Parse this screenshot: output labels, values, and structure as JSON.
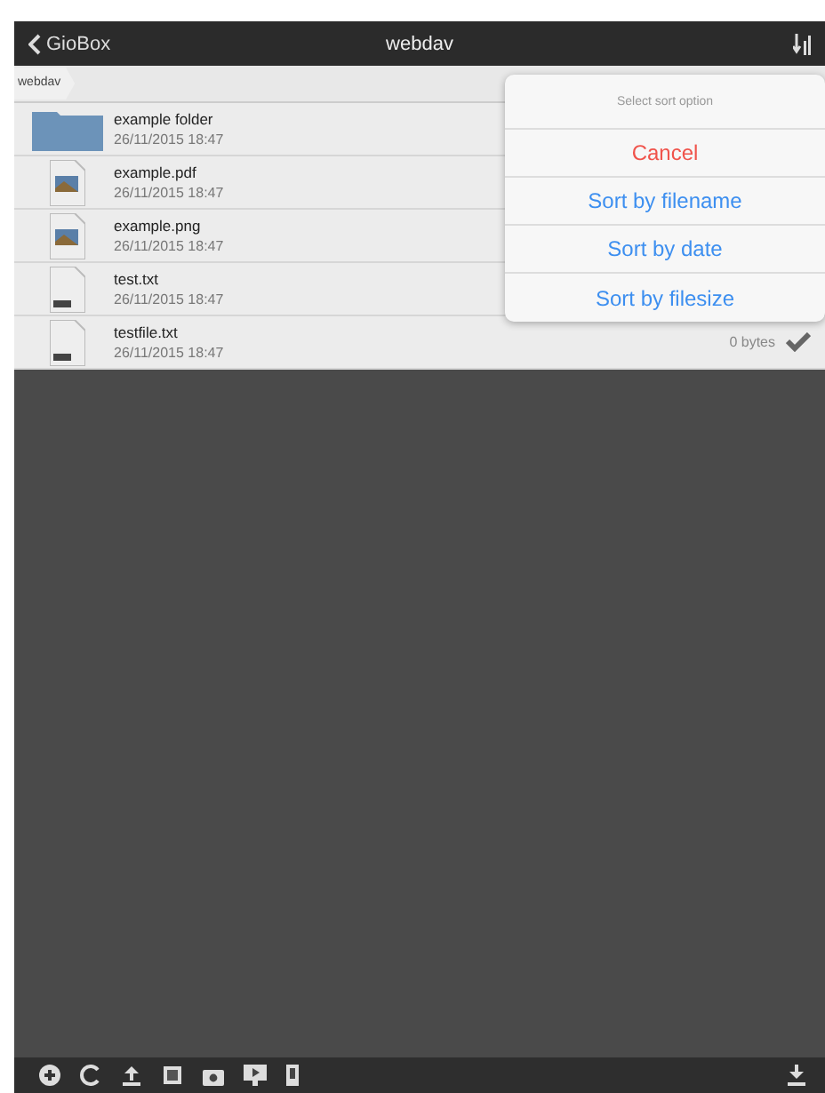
{
  "nav_bar": {
    "back_label": "GioBox",
    "title": "webdav"
  },
  "breadcrumb": [
    "webdav"
  ],
  "files": [
    {
      "kind": "folder",
      "name": "example folder",
      "date": "26/11/2015 18:47"
    },
    {
      "kind": "image",
      "name": "example.pdf",
      "date": "26/11/2015 18:47"
    },
    {
      "kind": "image",
      "name": "example.png",
      "date": "26/11/2015 18:47"
    },
    {
      "kind": "text",
      "name": "test.txt",
      "date": "26/11/2015 18:47"
    },
    {
      "kind": "text",
      "name": "testfile.txt",
      "date": "26/11/2015 18:47",
      "size": "0 bytes"
    }
  ],
  "sort_popover": {
    "title": "Select sort option",
    "options": [
      {
        "kind": "cancel",
        "label": "Cancel"
      },
      {
        "kind": "option",
        "label": "Sort by filename"
      },
      {
        "kind": "option",
        "label": "Sort by date"
      },
      {
        "kind": "option",
        "label": "Sort by filesize"
      }
    ]
  }
}
